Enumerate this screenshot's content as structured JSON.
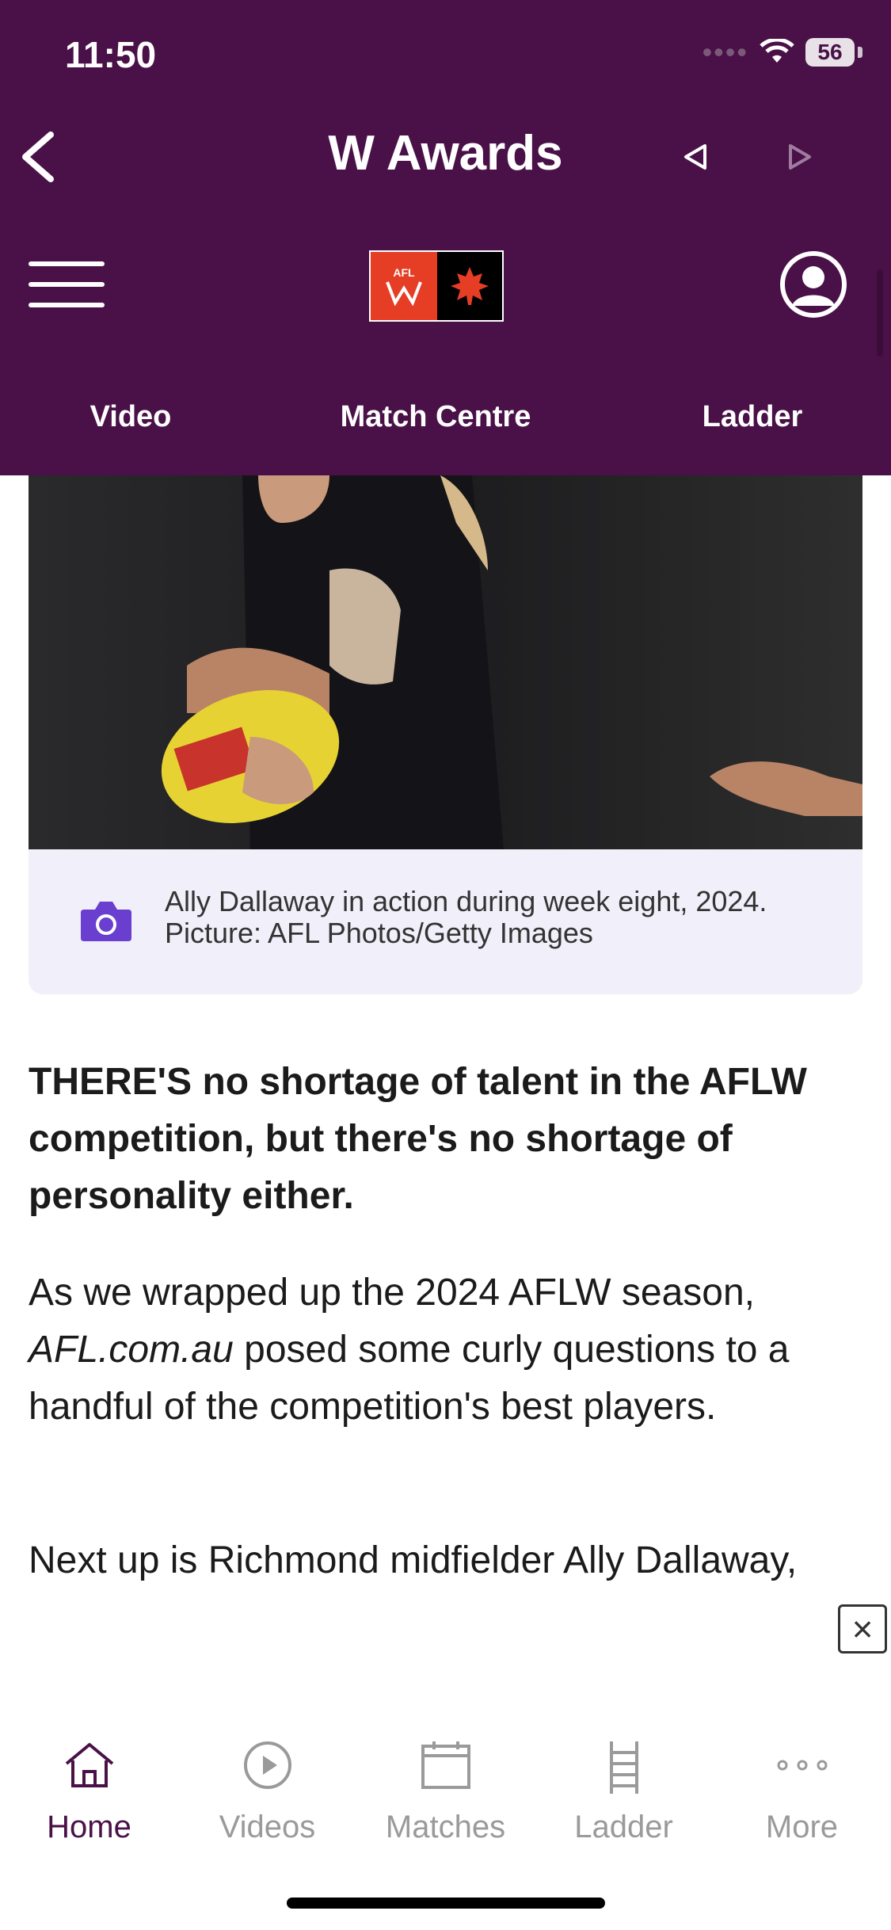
{
  "status": {
    "time": "11:50",
    "battery": "56"
  },
  "header": {
    "title": "W Awards",
    "logo_text": "AFL",
    "tabs": [
      {
        "label": "Video"
      },
      {
        "label": "Match Centre"
      },
      {
        "label": "Ladder"
      }
    ]
  },
  "article": {
    "caption": "Ally Dallaway in action during week eight, 2024. Picture: AFL Photos/Getty Images",
    "lead": "THERE'S no shortage of talent in the AFLW competition, but there's no shortage of personality either.",
    "para1_before": "As we wrapped up the 2024 AFLW season, ",
    "para1_italic": "AFL.com.au",
    "para1_after": " posed some curly questions to a handful of the competition's best players.",
    "para2": "Next up is Richmond midfielder Ally Dallaway,"
  },
  "tabbar": {
    "items": [
      {
        "label": "Home",
        "icon": "house-icon"
      },
      {
        "label": "Videos",
        "icon": "play-icon"
      },
      {
        "label": "Matches",
        "icon": "calendar-icon"
      },
      {
        "label": "Ladder",
        "icon": "ladder-icon"
      },
      {
        "label": "More",
        "icon": "more-icon"
      }
    ]
  },
  "colors": {
    "brand": "#4a1148",
    "active_tab": "#4a1148",
    "inactive_tab": "#9a9a9a",
    "caption_bg": "#f1eff9",
    "camera": "#6a3fd0"
  }
}
